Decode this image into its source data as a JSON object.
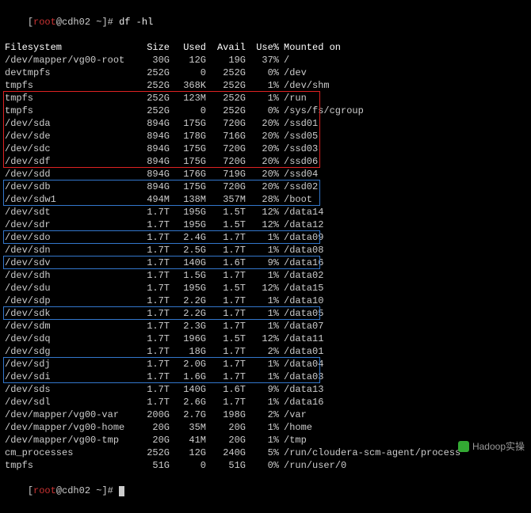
{
  "prompt": {
    "user": "root",
    "host": "cdh02",
    "path": "~",
    "command": "df -hl"
  },
  "headers": {
    "fs": "Filesystem",
    "size": "Size",
    "used": "Used",
    "avail": "Avail",
    "usep": "Use%",
    "mnt": "Mounted on"
  },
  "rows": [
    {
      "fs": "/dev/mapper/vg00-root",
      "size": "30G",
      "used": "12G",
      "avail": "19G",
      "usep": "37%",
      "mnt": "/"
    },
    {
      "fs": "devtmpfs",
      "size": "252G",
      "used": "0",
      "avail": "252G",
      "usep": "0%",
      "mnt": "/dev"
    },
    {
      "fs": "tmpfs",
      "size": "252G",
      "used": "368K",
      "avail": "252G",
      "usep": "1%",
      "mnt": "/dev/shm"
    },
    {
      "fs": "tmpfs",
      "size": "252G",
      "used": "123M",
      "avail": "252G",
      "usep": "1%",
      "mnt": "/run"
    },
    {
      "fs": "tmpfs",
      "size": "252G",
      "used": "0",
      "avail": "252G",
      "usep": "0%",
      "mnt": "/sys/fs/cgroup"
    },
    {
      "fs": "/dev/sda",
      "size": "894G",
      "used": "175G",
      "avail": "720G",
      "usep": "20%",
      "mnt": "/ssd01"
    },
    {
      "fs": "/dev/sde",
      "size": "894G",
      "used": "178G",
      "avail": "716G",
      "usep": "20%",
      "mnt": "/ssd05"
    },
    {
      "fs": "/dev/sdc",
      "size": "894G",
      "used": "175G",
      "avail": "720G",
      "usep": "20%",
      "mnt": "/ssd03"
    },
    {
      "fs": "/dev/sdf",
      "size": "894G",
      "used": "175G",
      "avail": "720G",
      "usep": "20%",
      "mnt": "/ssd06"
    },
    {
      "fs": "/dev/sdd",
      "size": "894G",
      "used": "176G",
      "avail": "719G",
      "usep": "20%",
      "mnt": "/ssd04"
    },
    {
      "fs": "/dev/sdb",
      "size": "894G",
      "used": "175G",
      "avail": "720G",
      "usep": "20%",
      "mnt": "/ssd02"
    },
    {
      "fs": "/dev/sdw1",
      "size": "494M",
      "used": "138M",
      "avail": "357M",
      "usep": "28%",
      "mnt": "/boot"
    },
    {
      "fs": "/dev/sdt",
      "size": "1.7T",
      "used": "195G",
      "avail": "1.5T",
      "usep": "12%",
      "mnt": "/data14"
    },
    {
      "fs": "/dev/sdr",
      "size": "1.7T",
      "used": "195G",
      "avail": "1.5T",
      "usep": "12%",
      "mnt": "/data12"
    },
    {
      "fs": "/dev/sdo",
      "size": "1.7T",
      "used": "2.4G",
      "avail": "1.7T",
      "usep": "1%",
      "mnt": "/data09"
    },
    {
      "fs": "/dev/sdn",
      "size": "1.7T",
      "used": "2.5G",
      "avail": "1.7T",
      "usep": "1%",
      "mnt": "/data08"
    },
    {
      "fs": "/dev/sdv",
      "size": "1.7T",
      "used": "140G",
      "avail": "1.6T",
      "usep": "9%",
      "mnt": "/data16"
    },
    {
      "fs": "/dev/sdh",
      "size": "1.7T",
      "used": "1.5G",
      "avail": "1.7T",
      "usep": "1%",
      "mnt": "/data02"
    },
    {
      "fs": "/dev/sdu",
      "size": "1.7T",
      "used": "195G",
      "avail": "1.5T",
      "usep": "12%",
      "mnt": "/data15"
    },
    {
      "fs": "/dev/sdp",
      "size": "1.7T",
      "used": "2.2G",
      "avail": "1.7T",
      "usep": "1%",
      "mnt": "/data10"
    },
    {
      "fs": "/dev/sdk",
      "size": "1.7T",
      "used": "2.2G",
      "avail": "1.7T",
      "usep": "1%",
      "mnt": "/data05"
    },
    {
      "fs": "/dev/sdm",
      "size": "1.7T",
      "used": "2.3G",
      "avail": "1.7T",
      "usep": "1%",
      "mnt": "/data07"
    },
    {
      "fs": "/dev/sdq",
      "size": "1.7T",
      "used": "196G",
      "avail": "1.5T",
      "usep": "12%",
      "mnt": "/data11"
    },
    {
      "fs": "/dev/sdg",
      "size": "1.7T",
      "used": "18G",
      "avail": "1.7T",
      "usep": "2%",
      "mnt": "/data01"
    },
    {
      "fs": "/dev/sdj",
      "size": "1.7T",
      "used": "2.0G",
      "avail": "1.7T",
      "usep": "1%",
      "mnt": "/data04"
    },
    {
      "fs": "/dev/sdi",
      "size": "1.7T",
      "used": "1.6G",
      "avail": "1.7T",
      "usep": "1%",
      "mnt": "/data03"
    },
    {
      "fs": "/dev/sds",
      "size": "1.7T",
      "used": "140G",
      "avail": "1.6T",
      "usep": "9%",
      "mnt": "/data13"
    },
    {
      "fs": "/dev/sdl",
      "size": "1.7T",
      "used": "2.6G",
      "avail": "1.7T",
      "usep": "1%",
      "mnt": "/data16"
    },
    {
      "fs": "/dev/mapper/vg00-var",
      "size": "200G",
      "used": "2.7G",
      "avail": "198G",
      "usep": "2%",
      "mnt": "/var"
    },
    {
      "fs": "/dev/mapper/vg00-home",
      "size": "20G",
      "used": "35M",
      "avail": "20G",
      "usep": "1%",
      "mnt": "/home"
    },
    {
      "fs": "/dev/mapper/vg00-tmp",
      "size": "20G",
      "used": "41M",
      "avail": "20G",
      "usep": "1%",
      "mnt": "/tmp"
    },
    {
      "fs": "cm_processes",
      "size": "252G",
      "used": "12G",
      "avail": "240G",
      "usep": "5%",
      "mnt": "/run/cloudera-scm-agent/process"
    },
    {
      "fs": "tmpfs",
      "size": "51G",
      "used": "0",
      "avail": "51G",
      "usep": "0%",
      "mnt": "/run/user/0"
    }
  ],
  "highlights": {
    "red_groups": [
      [
        5,
        10
      ]
    ],
    "blue_groups": [
      [
        12,
        13
      ],
      [
        16,
        16
      ],
      [
        18,
        18
      ],
      [
        22,
        22
      ],
      [
        26,
        27
      ]
    ]
  },
  "watermark": "Hadoop实操"
}
